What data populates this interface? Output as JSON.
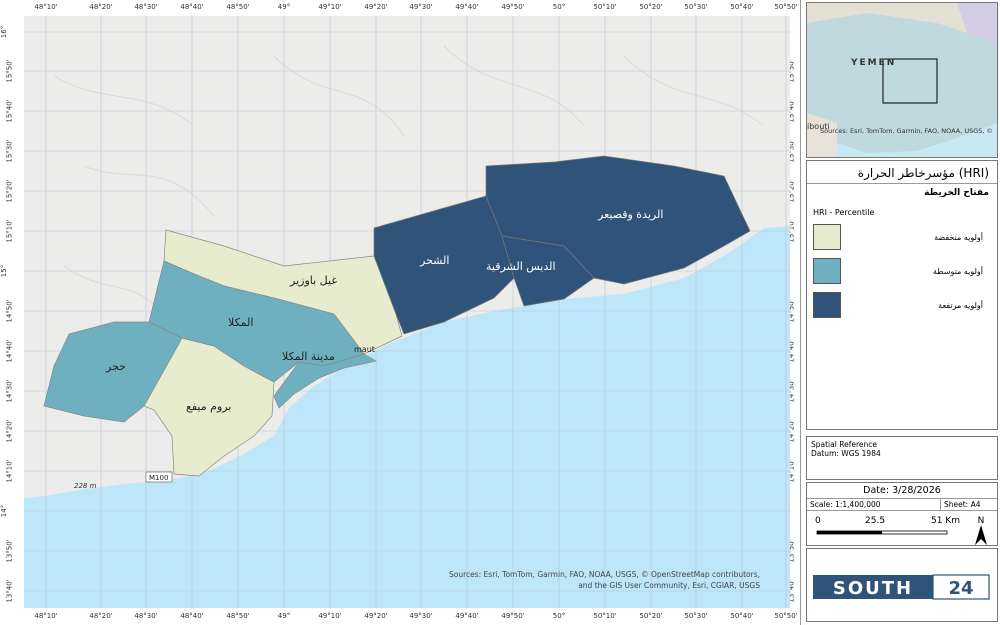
{
  "map": {
    "lon_ticks": [
      "48°10'",
      "48°20'",
      "48°30'",
      "48°40'",
      "48°50'",
      "49°",
      "49°10'",
      "49°20'",
      "49°30'",
      "49°40'",
      "49°50'",
      "50°",
      "50°10'",
      "50°20'",
      "50°30'",
      "50°40'",
      "50°50'"
    ],
    "lat_ticks": [
      "16°",
      "15°50'",
      "15°40'",
      "15°30'",
      "15°20'",
      "15°10'",
      "15°",
      "14°50'",
      "14°40'",
      "14°30'",
      "14°20'",
      "14°10'",
      "14°",
      "13°50'",
      "13°40'"
    ],
    "districts": [
      {
        "name": "غيل باوزير",
        "priority": "low"
      },
      {
        "name": "بروم ميفع",
        "priority": "low"
      },
      {
        "name": "المكلا",
        "priority": "medium"
      },
      {
        "name": "حجر",
        "priority": "medium"
      },
      {
        "name": "مدينة المكلا",
        "priority": "medium"
      },
      {
        "name": "الشحر",
        "priority": "high"
      },
      {
        "name": "الديس الشرقية",
        "priority": "high"
      },
      {
        "name": "الريدة وقصيعر",
        "priority": "high"
      }
    ],
    "labels": {
      "road": "M100",
      "elevation": "228 m",
      "place_fragment": "maut"
    },
    "sources": "Sources: Esri, TomTom, Garmin, FAO, NOAA, USGS, © OpenStreetMap contributors,",
    "sources2": "and the GIS User Community, Esri, CGIAR, USGS",
    "colors": {
      "sea": "#bde6fb",
      "land": "#ececea",
      "low": "#e7ecce",
      "medium": "#6fb0c0",
      "high": "#2f5379"
    }
  },
  "inset": {
    "country": "YEMEN",
    "neighbor": "ibouti",
    "sources": "Sources: Esri, TomTom, Garmin, FAO, NOAA, USGS, ©"
  },
  "legend": {
    "title": "مؤسرخاطر الحرارة (HRI)",
    "subtitle": "مفتاح الخريطة",
    "field": "HRI - Percentile",
    "items": [
      {
        "label": "أولويه منخفضة",
        "color": "#e7ecce"
      },
      {
        "label": "أولويه متوسطة",
        "color": "#6fb0c0"
      },
      {
        "label": "أولويه مرتفعة",
        "color": "#2f5379"
      }
    ]
  },
  "spatial": {
    "line1": "Spatial Reference",
    "line2": "Datum: WGS 1984"
  },
  "info": {
    "date": "Date: 3/28/2026",
    "scale": "Scale: 1:1,400,000",
    "sheet": "Sheet: A4",
    "bar": [
      "0",
      "25.5",
      "51 Km"
    ],
    "north": "N"
  },
  "logo": {
    "part1": "SOUTH",
    "part2": "24"
  }
}
